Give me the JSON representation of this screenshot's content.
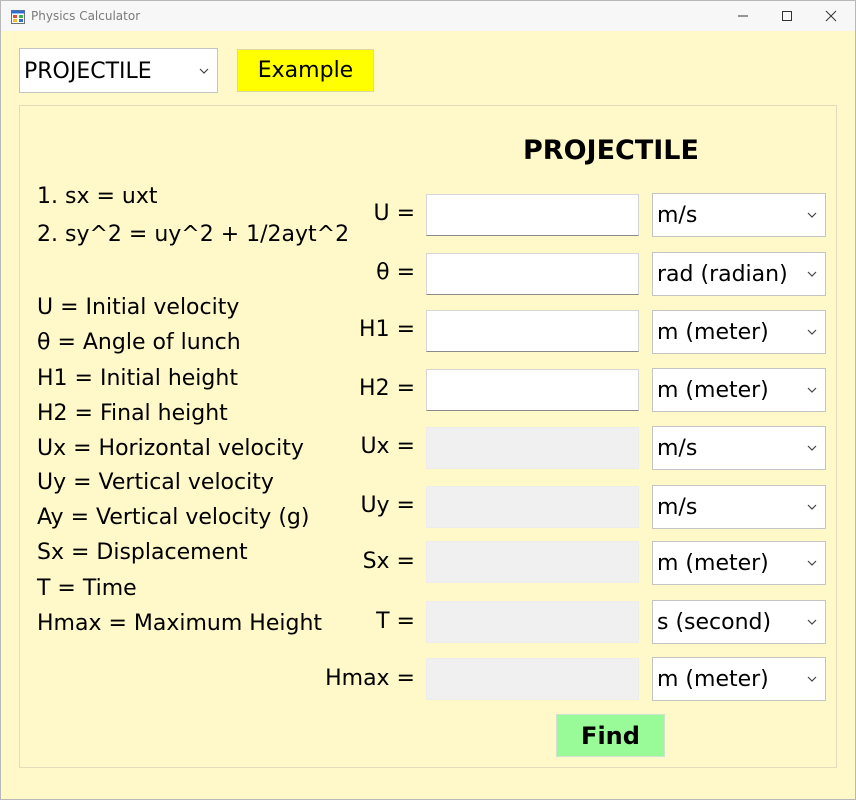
{
  "window": {
    "title": "Physics Calculator"
  },
  "toolbar": {
    "mode_selected": "PROJECTILE",
    "example_label": "Example"
  },
  "panel": {
    "heading": "PROJECTILE",
    "equations": [
      "1. sx = uxt",
      "2. sy^2 = uy^2 + 1/2ayt^2"
    ],
    "legend": [
      "U = Initial velocity",
      "θ = Angle of lunch",
      "H1 = Initial height",
      "H2 = Final height",
      "Ux = Horizontal velocity",
      "Uy =  Vertical velocity",
      "Ay = Vertical velocity (g)",
      "Sx = Displacement",
      "T = Time",
      "Hmax = Maximum Height"
    ],
    "fields": [
      {
        "label": "U =",
        "value": "",
        "unit": "m/s",
        "editable": true
      },
      {
        "label": "θ =",
        "value": "",
        "unit": "rad (radian)",
        "editable": true
      },
      {
        "label": "H1 =",
        "value": "",
        "unit": "m (meter)",
        "editable": true
      },
      {
        "label": "H2 =",
        "value": "",
        "unit": "m (meter)",
        "editable": true
      },
      {
        "label": "Ux =",
        "value": "",
        "unit": "m/s",
        "editable": false
      },
      {
        "label": "Uy =",
        "value": "",
        "unit": "m/s",
        "editable": false
      },
      {
        "label": "Sx =",
        "value": "",
        "unit": "m (meter)",
        "editable": false
      },
      {
        "label": "T =",
        "value": "",
        "unit": "s (second)",
        "editable": false
      },
      {
        "label": "Hmax =",
        "value": "",
        "unit": "m (meter)",
        "editable": false
      }
    ],
    "find_label": "Find"
  },
  "colors": {
    "background": "#fff8c8",
    "example_button": "#ffff00",
    "find_button": "#98fb98",
    "readonly_field": "#f0f0f0"
  },
  "icons": {
    "app": "app-window-icon",
    "minimize": "minimize-icon",
    "maximize": "maximize-icon",
    "close": "close-icon",
    "dropdown": "chevron-down-icon"
  }
}
